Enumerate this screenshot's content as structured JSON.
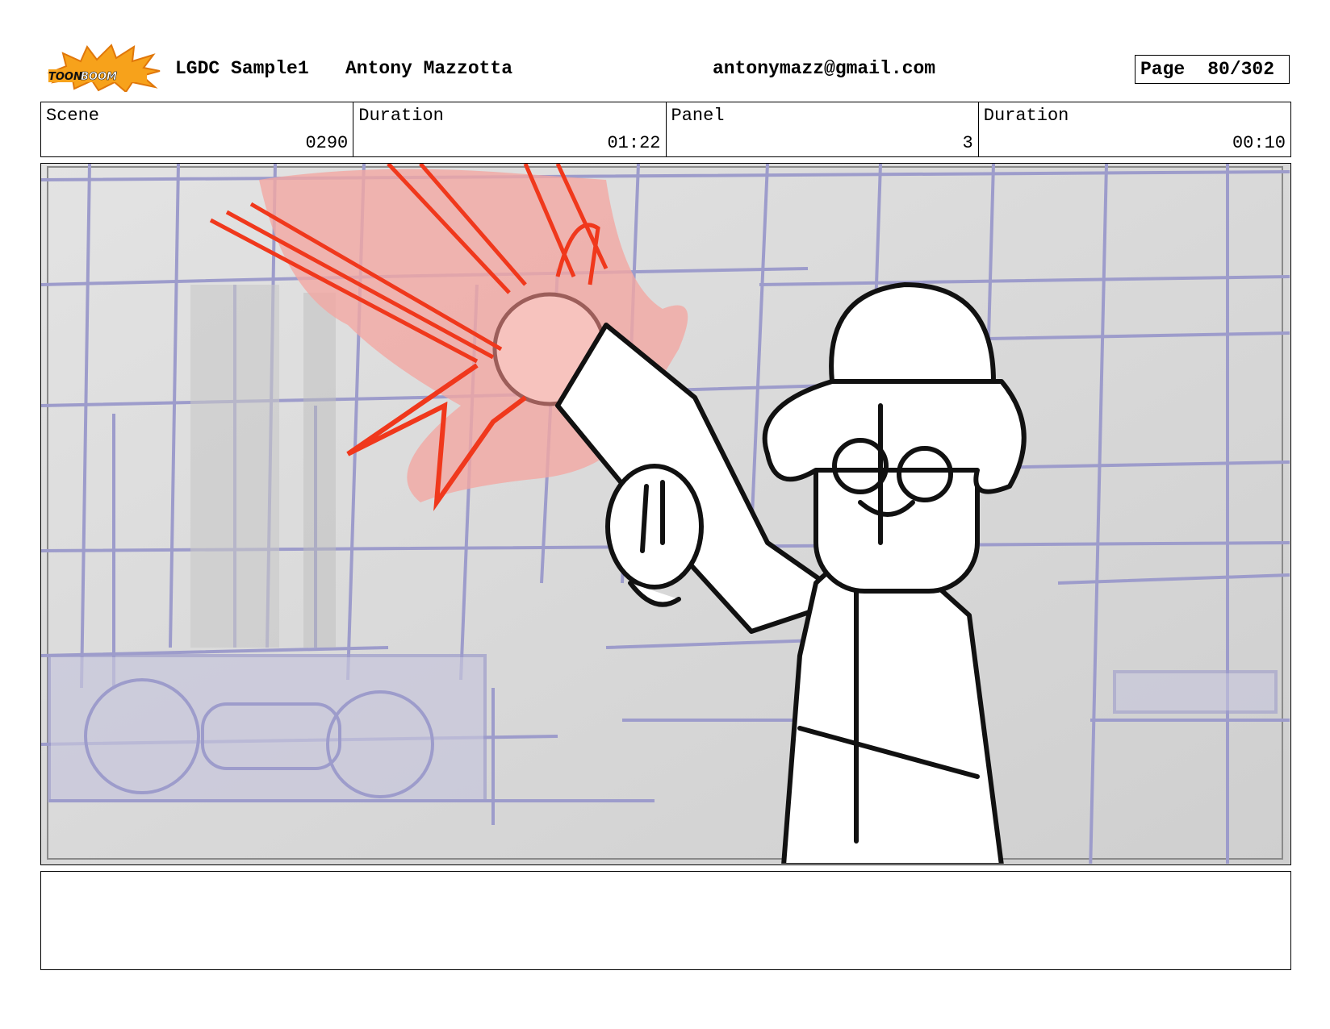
{
  "header": {
    "logo_text": "TOONBOOM",
    "project": "LGDC Sample1",
    "author": "Antony Mazzotta",
    "email": "antonymazz@gmail.com",
    "page_label": "Page",
    "page_value": "80/302"
  },
  "info": {
    "scene_label": "Scene",
    "scene_value": "0290",
    "scene_duration_label": "Duration",
    "scene_duration_value": "01:22",
    "panel_label": "Panel",
    "panel_value": "3",
    "panel_duration_label": "Duration",
    "panel_duration_value": "00:10"
  },
  "notes": {
    "text": ""
  }
}
